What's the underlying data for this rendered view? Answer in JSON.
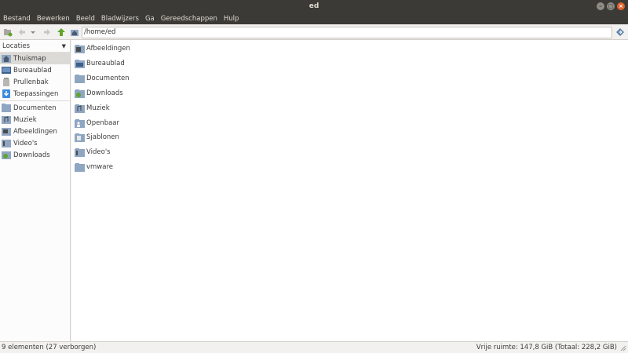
{
  "window": {
    "title": "ed"
  },
  "menu": [
    "Bestand",
    "Bewerken",
    "Beeld",
    "Bladwijzers",
    "Ga",
    "Gereedschappen",
    "Hulp"
  ],
  "toolbar": {
    "path": "/home/ed"
  },
  "sidebar": {
    "header": "Locaties",
    "places": [
      {
        "label": "Thuismap",
        "icon": "home-folder-icon",
        "selected": true
      },
      {
        "label": "Bureaublad",
        "icon": "desktop-icon"
      },
      {
        "label": "Prullenbak",
        "icon": "trash-icon"
      },
      {
        "label": "Toepassingen",
        "icon": "applications-icon"
      }
    ],
    "bookmarks": [
      {
        "label": "Documenten",
        "icon": "folder-icon"
      },
      {
        "label": "Muziek",
        "icon": "music-folder-icon"
      },
      {
        "label": "Afbeeldingen",
        "icon": "pictures-folder-icon"
      },
      {
        "label": "Video's",
        "icon": "videos-folder-icon"
      },
      {
        "label": "Downloads",
        "icon": "downloads-folder-icon"
      }
    ]
  },
  "files": [
    {
      "name": "Afbeeldingen",
      "icon": "pictures-folder-icon"
    },
    {
      "name": "Bureaublad",
      "icon": "desktop-folder-icon"
    },
    {
      "name": "Documenten",
      "icon": "folder-icon"
    },
    {
      "name": "Downloads",
      "icon": "downloads-folder-icon"
    },
    {
      "name": "Muziek",
      "icon": "music-folder-icon"
    },
    {
      "name": "Openbaar",
      "icon": "public-folder-icon"
    },
    {
      "name": "Sjablonen",
      "icon": "templates-folder-icon"
    },
    {
      "name": "Video's",
      "icon": "videos-folder-icon"
    },
    {
      "name": "vmware",
      "icon": "folder-icon"
    }
  ],
  "status": {
    "left": "9 elementen (27 verborgen)",
    "right": "Vrije ruimte: 147,8 GiB (Totaal: 228,2 GiB)"
  },
  "colors": {
    "titlebar": "#3b3a36",
    "close": "#e0632c",
    "folder": "#8fa6c2",
    "up_arrow": "#5fa62c"
  }
}
